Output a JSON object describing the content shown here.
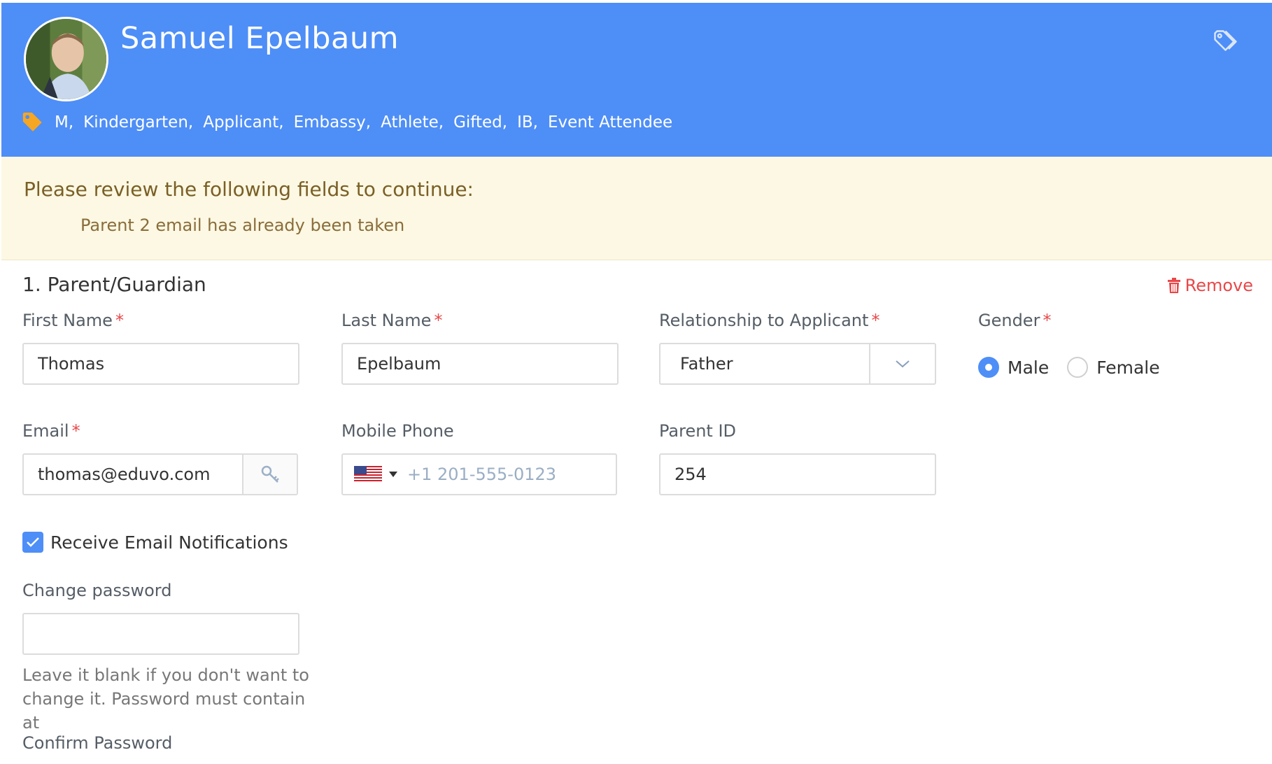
{
  "header": {
    "name": "Samuel Epelbaum",
    "tags": [
      "M,",
      "Kindergarten,",
      "Applicant,",
      "Embassy,",
      "Athlete,",
      "Gifted,",
      "IB,",
      "Event Attendee"
    ],
    "accent_color": "#4e8ef7",
    "tag_color": "#f5a623"
  },
  "alert": {
    "title": "Please review the following fields to continue:",
    "message": "Parent 2 email has already been taken"
  },
  "section": {
    "title": "1. Parent/Guardian",
    "remove_label": "Remove"
  },
  "form": {
    "first_name": {
      "label": "First Name",
      "required": "*",
      "value": "Thomas"
    },
    "last_name": {
      "label": "Last Name",
      "required": "*",
      "value": "Epelbaum"
    },
    "relationship": {
      "label": "Relationship to Applicant",
      "required": "*",
      "value": "Father"
    },
    "gender": {
      "label": "Gender",
      "required": "*",
      "options": [
        "Male",
        "Female"
      ],
      "selected": "Male"
    },
    "email": {
      "label": "Email",
      "required": "*",
      "value": "thomas@eduvo.com"
    },
    "mobile_phone": {
      "label": "Mobile Phone",
      "placeholder": "+1 201-555-0123"
    },
    "parent_id": {
      "label": "Parent ID",
      "value": "254"
    },
    "email_notifications": {
      "label": "Receive Email Notifications",
      "checked": true
    },
    "change_password": {
      "label": "Change password",
      "value": "",
      "help": "Leave it blank if you don't want to change it. Password must contain at"
    },
    "confirm_password": {
      "label": "Confirm Password"
    }
  },
  "icons": {
    "header_tag": "tag-outline-icon",
    "tags_label": "tag-icon",
    "remove": "trash-icon",
    "select_arrow": "chevron-down-icon",
    "email_key": "key-icon",
    "phone_flag": "us-flag-icon",
    "check": "checkmark-icon"
  }
}
